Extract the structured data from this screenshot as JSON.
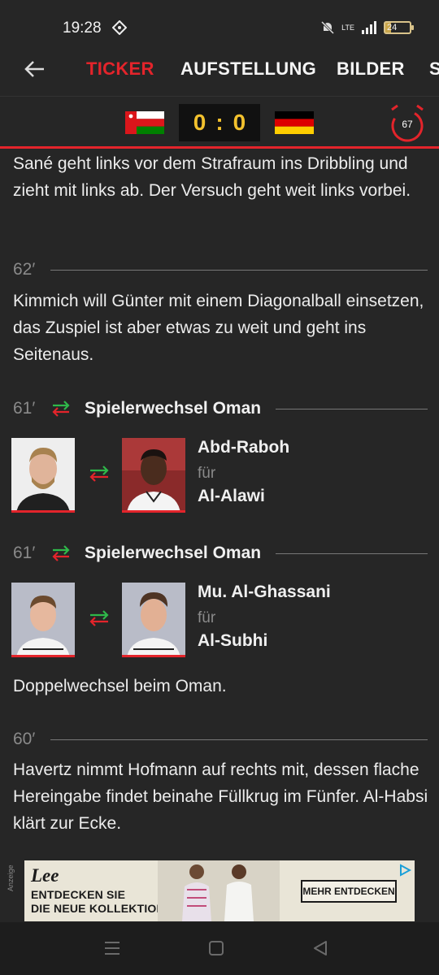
{
  "status_bar": {
    "time": "19:28",
    "network": "LTE",
    "battery": "24"
  },
  "tabs": [
    "TICKER",
    "AUFSTELLUNG",
    "BILDER",
    "S"
  ],
  "match": {
    "home_score": "0",
    "separator": ":",
    "away_score": "0",
    "clock": "67",
    "home_team": "Oman",
    "away_team": "Deutschland"
  },
  "ticker": {
    "entry0_text": "Sané geht links vor dem Strafraum ins Dribbling und zieht mit links ab. Der Versuch geht weit links vorbei.",
    "entry1_minute": "62′",
    "entry1_text": "Kimmich will Günter mit einem Diagonalball einsetzen, das Zuspiel ist aber etwas zu weit und geht ins Seitenaus.",
    "sub1": {
      "minute": "61′",
      "title": "Spielerwechsel Oman",
      "player_in": "Abd-Raboh",
      "for_label": "für",
      "player_out": "Al-Alawi"
    },
    "sub2": {
      "minute": "61′",
      "title": "Spielerwechsel Oman",
      "player_in": "Mu. Al-Ghassani",
      "for_label": "für",
      "player_out": "Al-Subhi"
    },
    "entry2_text": "Doppelwechsel beim Oman.",
    "entry3_minute": "60′",
    "entry3_text": "Havertz nimmt Hofmann auf rechts mit, dessen flache Hereingabe findet beinahe Füllkrug im Fünfer. Al-Habsi klärt zur Ecke."
  },
  "ad": {
    "label": "Anzeige",
    "brand": "Lee",
    "line1": "ENTDECKEN SIE",
    "line2": "DIE NEUE KOLLEKTION",
    "cta": "MEHR ENTDECKEN"
  },
  "colors": {
    "accent": "#e3242b",
    "score": "#f2c12e",
    "background": "#262626"
  }
}
